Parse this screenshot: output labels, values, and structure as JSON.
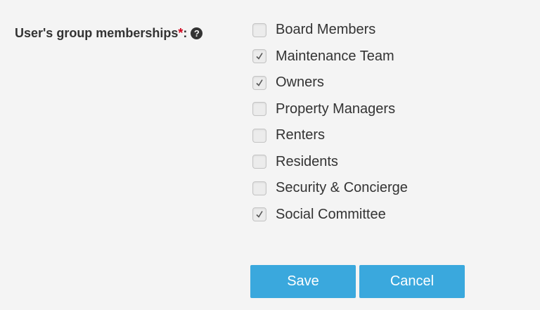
{
  "form": {
    "label": "User's group memberships",
    "required_mark": "*",
    "colon": ":",
    "help_icon": "question-circle-icon",
    "help_glyph": "?"
  },
  "groups": [
    {
      "label": "Board Members",
      "checked": false
    },
    {
      "label": "Maintenance Team",
      "checked": true
    },
    {
      "label": "Owners",
      "checked": true
    },
    {
      "label": "Property Managers",
      "checked": false
    },
    {
      "label": "Renters",
      "checked": false
    },
    {
      "label": "Residents",
      "checked": false
    },
    {
      "label": "Security & Concierge",
      "checked": false
    },
    {
      "label": "Social Committee",
      "checked": true
    }
  ],
  "actions": {
    "save_label": "Save",
    "cancel_label": "Cancel"
  },
  "colors": {
    "button": "#3aa8dd",
    "required": "#d0021b",
    "background": "#f4f4f4"
  }
}
